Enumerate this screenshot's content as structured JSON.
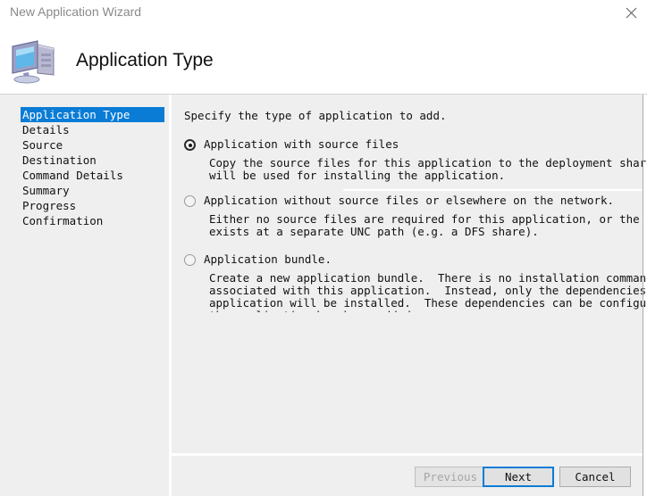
{
  "window": {
    "title": "New Application Wizard",
    "close_icon": "close-icon"
  },
  "header": {
    "title": "Application Type",
    "icon": "computer-icon"
  },
  "sidebar": {
    "items": [
      {
        "label": "Application Type",
        "active": true
      },
      {
        "label": "Details",
        "active": false
      },
      {
        "label": "Source",
        "active": false
      },
      {
        "label": "Destination",
        "active": false
      },
      {
        "label": "Command Details",
        "active": false
      },
      {
        "label": "Summary",
        "active": false
      },
      {
        "label": "Progress",
        "active": false
      },
      {
        "label": "Confirmation",
        "active": false
      }
    ]
  },
  "main": {
    "intro": "Specify the type of application to add.",
    "options": [
      {
        "label": "Application with source files",
        "selected": true,
        "description_lines": [
          "Copy the source files for this application to the deployment share, which",
          "will be used for installing the application."
        ]
      },
      {
        "label": "Application without source files or elsewhere on the network.",
        "selected": false,
        "description_lines": [
          "Either no source files are required for this application, or the application",
          "exists at a separate UNC path (e.g. a DFS share)."
        ]
      },
      {
        "label": "Application bundle.",
        "selected": false,
        "description_lines": [
          "Create a new application bundle.  There is no installation command",
          "associated with this application.  Instead, only the dependencies of this",
          "application will be installed.  These dependencies can be configured after",
          "the application has been added."
        ]
      }
    ]
  },
  "footer": {
    "previous_label": "Previous",
    "next_label": "Next",
    "cancel_label": "Cancel"
  },
  "colors": {
    "accent": "#0a7cd6",
    "panel": "#efefef",
    "text": "#111111",
    "muted": "#8a8a8a",
    "button_face": "#e1e1e1",
    "button_border": "#adadad"
  }
}
